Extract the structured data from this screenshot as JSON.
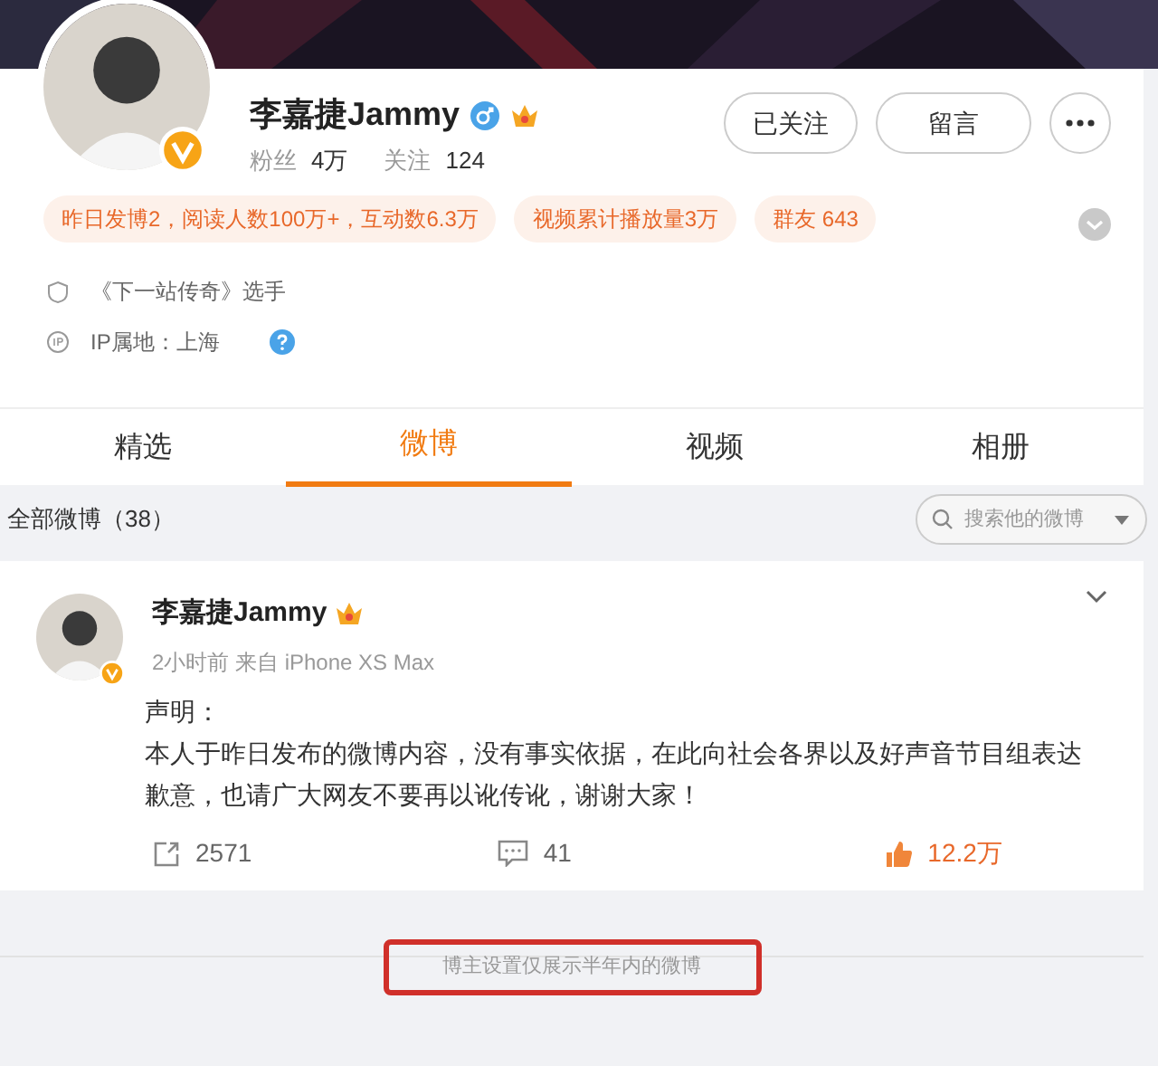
{
  "profile": {
    "name": "李嘉捷Jammy",
    "fans_label": "粉丝",
    "fans": "4万",
    "follow_label": "关注",
    "follow": "124",
    "buttons": [
      "已关注",
      "留言"
    ],
    "chips": [
      "昨日发博2，阅读人数100万+，互动数6.3万",
      "视频累计播放量3万",
      "群友 643"
    ],
    "show_title": "《下一站传奇》选手",
    "ip": "IP属地：上海"
  },
  "tabs": [
    {
      "label": "精选",
      "selected": false
    },
    {
      "label": "微博",
      "selected": true
    },
    {
      "label": "视频",
      "selected": false
    },
    {
      "label": "相册",
      "selected": false
    }
  ],
  "feed": {
    "title": "全部微博（38）",
    "search_placeholder": "搜索他的微博"
  },
  "post": {
    "author": "李嘉捷Jammy",
    "meta": "2小时前 来自 iPhone XS Max",
    "heading": "声明：",
    "body": "本人于昨日发布的微博内容，没有事实依据，在此向社会各界以及好声音节目组表达歉意，也请广大网友不要再以讹传讹，谢谢大家！",
    "reposts": "2571",
    "comments": "41",
    "likes": "12.2万",
    "liked": true
  },
  "notice": "博主设置仅展示半年内的微博"
}
